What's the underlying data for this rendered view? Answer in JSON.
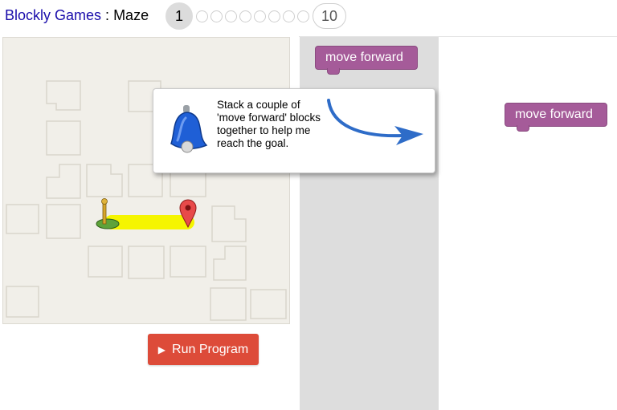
{
  "header": {
    "site_link": "Blockly Games",
    "separator": " : ",
    "game_name": "Maze",
    "current_level": "1",
    "last_level": "10",
    "intermediate_level_count": 8
  },
  "buttons": {
    "run_program": "Run Program",
    "run_icon": "play-icon"
  },
  "toolbox": {
    "blocks": [
      "move forward"
    ]
  },
  "workspace": {
    "blocks": [
      "move forward"
    ]
  },
  "help_bubble": {
    "text": "Stack a couple of 'move forward' blocks together to help me reach the goal.",
    "icon": "bell-icon",
    "pointer": "curved-arrow-icon"
  },
  "colors": {
    "block": "#a55b99",
    "run_button": "#dd4b39",
    "path": "#f5f500",
    "toolbox": "#dddddd",
    "link": "#1a0dab"
  }
}
